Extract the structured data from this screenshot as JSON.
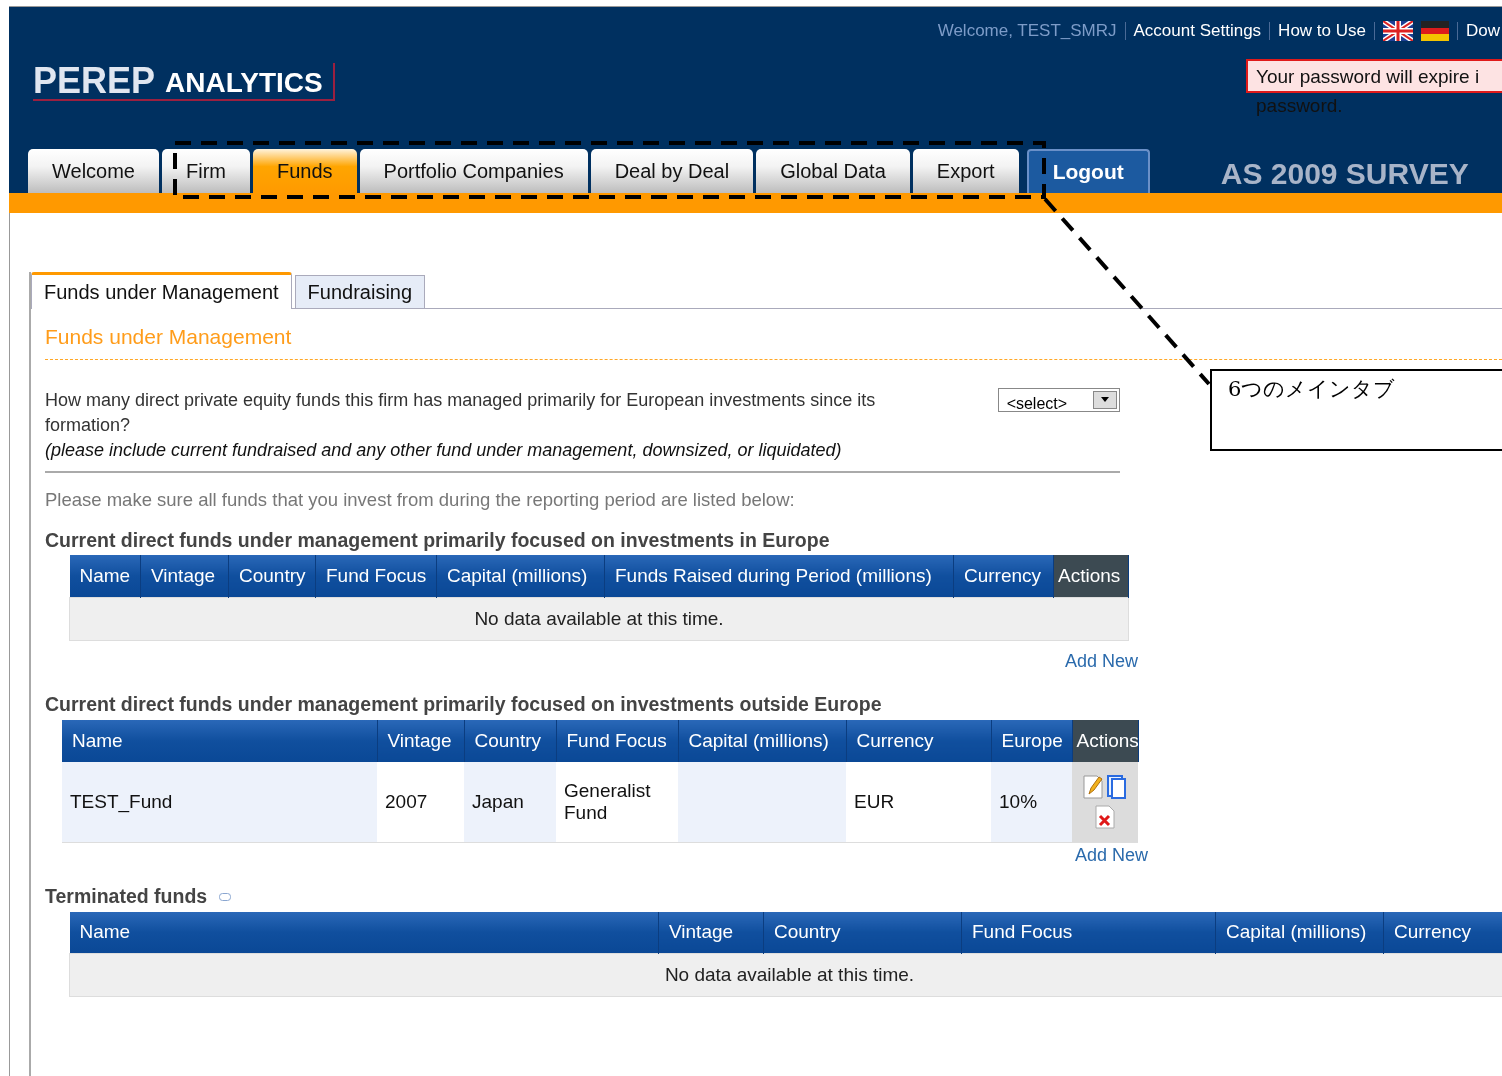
{
  "header": {
    "logo": {
      "main": "PEREP",
      "sub": "ANALYTICS"
    },
    "user_greeting": "Welcome, TEST_SMRJ",
    "top_links": [
      {
        "kind": "link",
        "label": "Account Settings"
      },
      {
        "kind": "link",
        "label": "How to Use"
      },
      {
        "kind": "flags"
      },
      {
        "kind": "link",
        "label": "Dow"
      }
    ],
    "password_notice": [
      "Your password will expire i",
      "password."
    ],
    "main_tabs": [
      {
        "label": "Welcome",
        "selected": false
      },
      {
        "label": "Firm",
        "selected": false
      },
      {
        "label": "Funds",
        "selected": true
      },
      {
        "label": "Portfolio Companies",
        "selected": false
      },
      {
        "label": "Deal by Deal",
        "selected": false
      },
      {
        "label": "Global Data",
        "selected": false
      },
      {
        "label": "Export",
        "selected": false
      }
    ],
    "logout": "Logout",
    "survey_title": "AS 2009 SURVEY"
  },
  "sub_tabs": [
    {
      "label": "Funds under Management",
      "selected": true
    },
    {
      "label": "Fundraising",
      "selected": false
    }
  ],
  "section_title": "Funds under Management",
  "question": {
    "text": "How many direct private equity funds this firm has managed primarily for European investments since its formation?",
    "note": "(please include current fundraised and any other fund under management, downsized, or liquidated)",
    "select_placeholder": "<select>"
  },
  "info": "Please make sure all funds that you invest from during the reporting period are listed below:",
  "tables": [
    {
      "title": "Current direct funds under management primarily focused on investments in Europe",
      "columns": [
        {
          "label": "Name",
          "kind": "data"
        },
        {
          "label": "Vintage",
          "kind": "data"
        },
        {
          "label": "Country",
          "kind": "data"
        },
        {
          "label": "Fund Focus",
          "kind": "data"
        },
        {
          "label": "Capital (millions)",
          "kind": "data"
        },
        {
          "label": "Funds Raised during Period (millions)",
          "kind": "data"
        },
        {
          "label": "Currency",
          "kind": "data"
        },
        {
          "label": "Actions",
          "kind": "actions"
        }
      ],
      "empty_message": "No data available at this time.",
      "add_new": "Add New"
    },
    {
      "title": "Current direct funds under management primarily focused on investments outside Europe",
      "columns": [
        {
          "label": "Name",
          "kind": "data"
        },
        {
          "label": "Vintage",
          "kind": "data"
        },
        {
          "label": "Country",
          "kind": "data"
        },
        {
          "label": "Fund Focus",
          "kind": "data"
        },
        {
          "label": "Capital (millions)",
          "kind": "data"
        },
        {
          "label": "Currency",
          "kind": "data"
        },
        {
          "label": "Europe",
          "kind": "data"
        },
        {
          "label": "Actions",
          "kind": "actions"
        }
      ],
      "rows": [
        [
          "TEST_Fund",
          "2007",
          "Japan",
          "Generalist Fund",
          "",
          "EUR",
          "10%"
        ]
      ],
      "add_new": "Add New"
    },
    {
      "title": "Terminated funds",
      "collapse_icon": true,
      "columns": [
        {
          "label": "Name",
          "kind": "data"
        },
        {
          "label": "Vintage",
          "kind": "data"
        },
        {
          "label": "Country",
          "kind": "data"
        },
        {
          "label": "Fund Focus",
          "kind": "data"
        },
        {
          "label": "Capital (millions)",
          "kind": "data"
        },
        {
          "label": "Currency",
          "kind": "data"
        }
      ],
      "empty_message": "No data available at this time."
    }
  ],
  "annotation": {
    "text": "6つのメインタブ"
  }
}
